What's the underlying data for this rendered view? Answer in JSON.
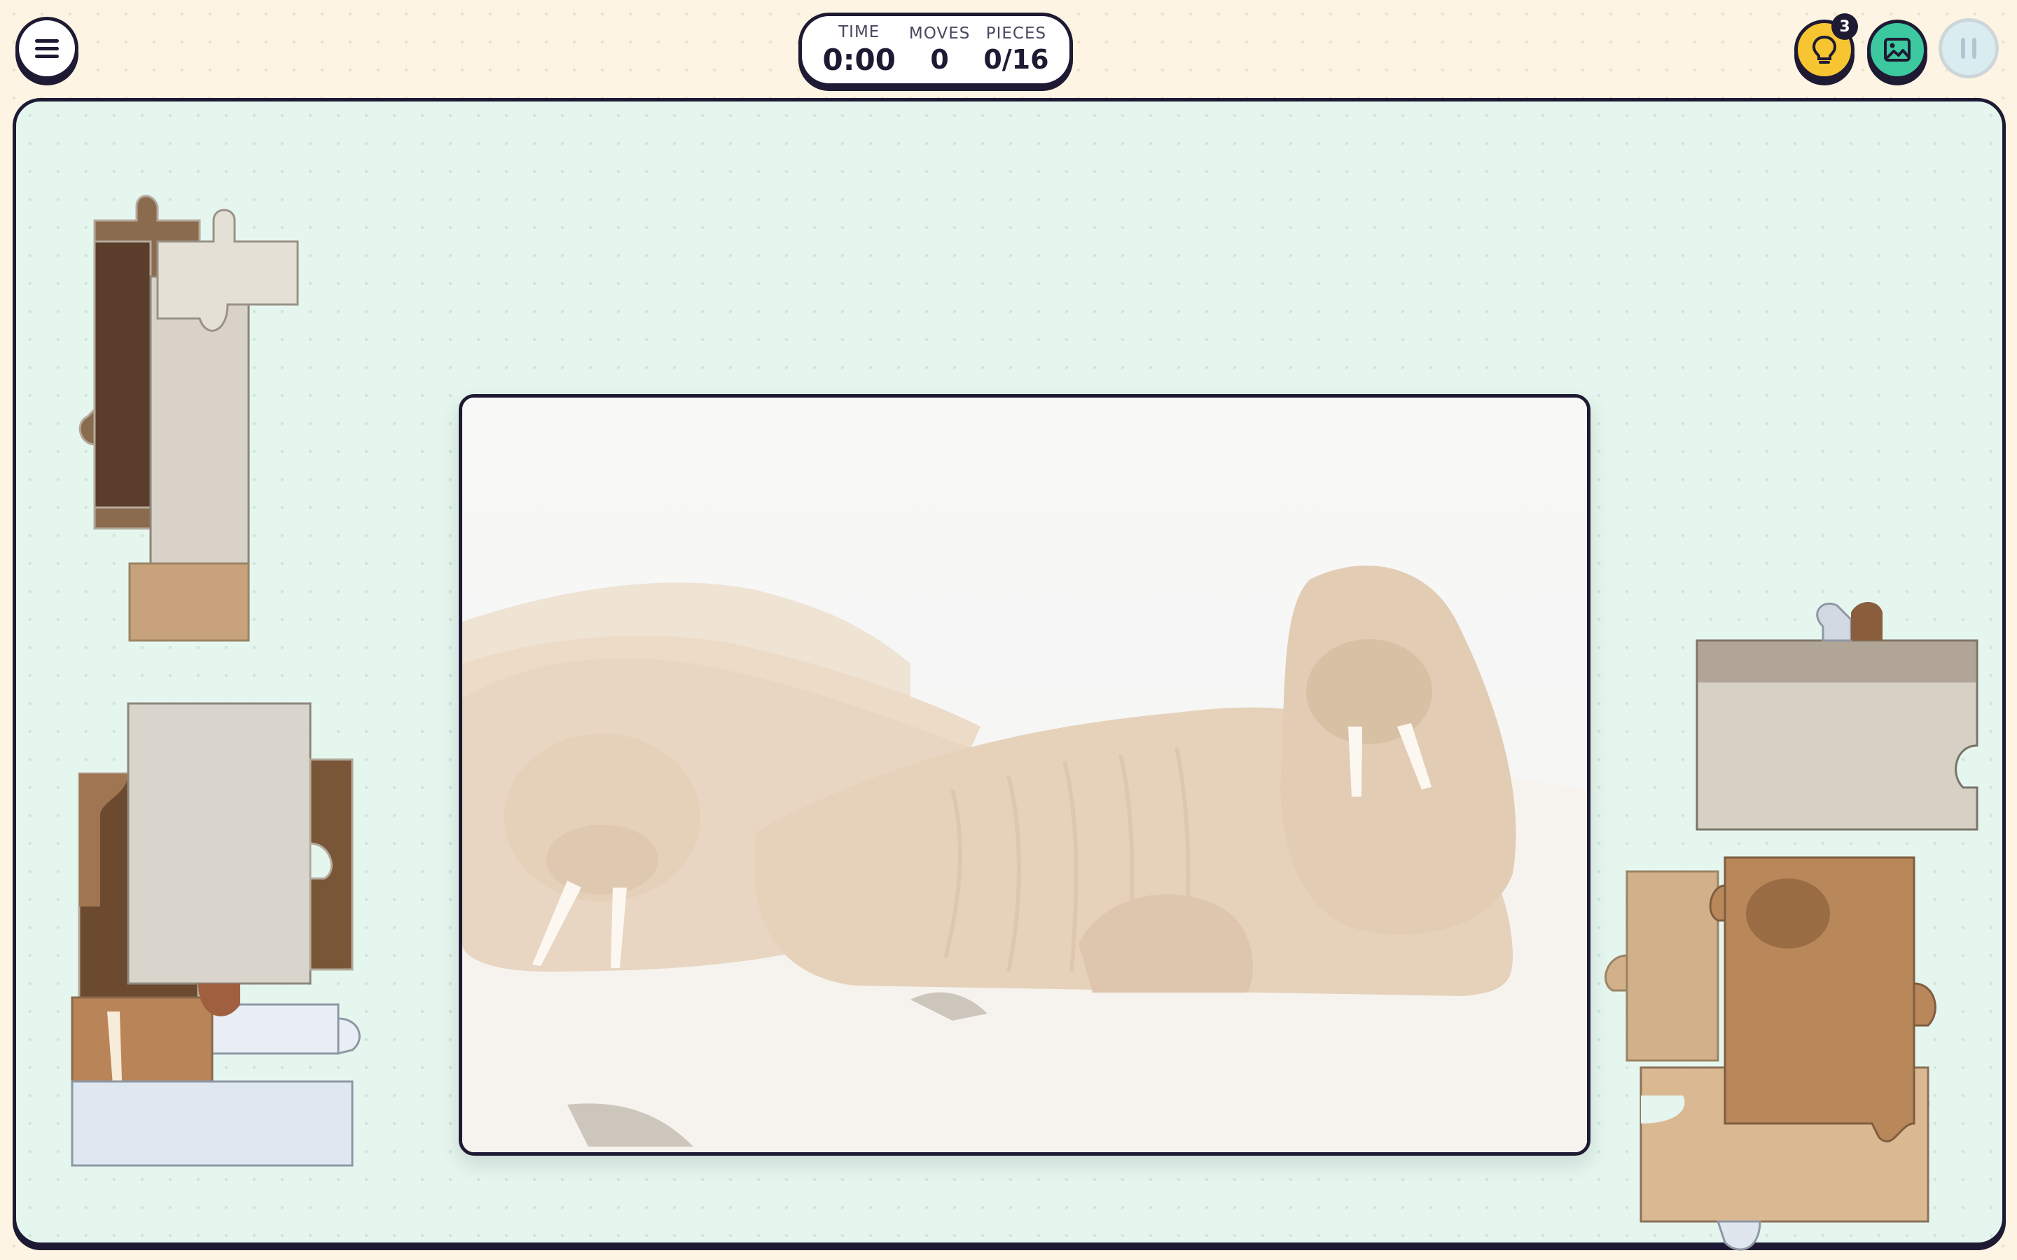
{
  "header": {
    "menu_icon": "menu-icon",
    "stats": {
      "time_label": "TIME",
      "time_value": "0:00",
      "moves_label": "MOVES",
      "moves_value": "0",
      "pieces_label": "PIECES",
      "pieces_value": "0/16"
    },
    "hint": {
      "icon": "lightbulb-icon",
      "count": "3",
      "color": "#f7c531"
    },
    "preview": {
      "icon": "image-icon",
      "color": "#3dc9a0"
    },
    "pause": {
      "icon": "pause-icon"
    }
  },
  "board": {
    "puzzle_subject": "walruses on sand",
    "colors": {
      "board_bg": "#e5f6ef",
      "outline": "#1e1a33",
      "sand": "#f1ede6",
      "walrus": "#c9a37a"
    }
  }
}
